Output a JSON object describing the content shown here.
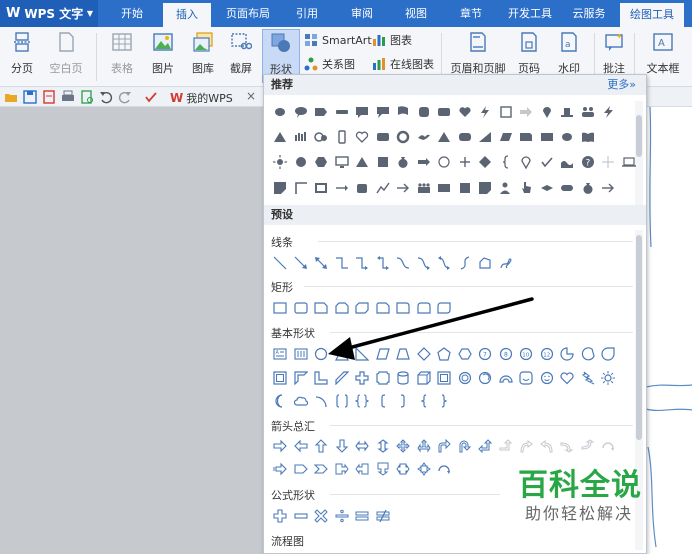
{
  "app": {
    "name": "WPS 文字"
  },
  "tabs": [
    "开始",
    "插入",
    "页面布局",
    "引用",
    "审阅",
    "视图",
    "章节",
    "开发工具",
    "云服务",
    "绘图工具"
  ],
  "active_tab": "插入",
  "ribbon": {
    "page_break": "分页",
    "blank_page": "空白页",
    "table": "表格",
    "picture": "图片",
    "gallery": "图库",
    "screenshot": "截屏",
    "shapes": "形状",
    "smartart": "SmartArt",
    "chart": "图表",
    "relation": "关系图",
    "online_chart": "在线图表",
    "header_footer": "页眉和页脚",
    "page_number": "页码",
    "watermark": "水印",
    "comment": "批注",
    "textbox": "文本框"
  },
  "quickbar": {
    "mywps": "我的WPS",
    "close": "×"
  },
  "panel": {
    "recommended": "推荐",
    "more": "更多»",
    "preset": "预设",
    "categories": {
      "lines": "线条",
      "rect": "矩形",
      "basic": "基本形状",
      "arrows": "箭头总汇",
      "formula": "公式形状",
      "flowchart": "流程图"
    }
  },
  "watermark_overlay": {
    "title": "百科全说",
    "subtitle": "助你轻松解决"
  },
  "colors": {
    "title_bar": "#2b6fc9",
    "ribbon_bg": "#f4f6f9",
    "shape_stroke": "#4a79b8",
    "shape_fill": "#5b6472",
    "brand_green": "#29a745"
  }
}
